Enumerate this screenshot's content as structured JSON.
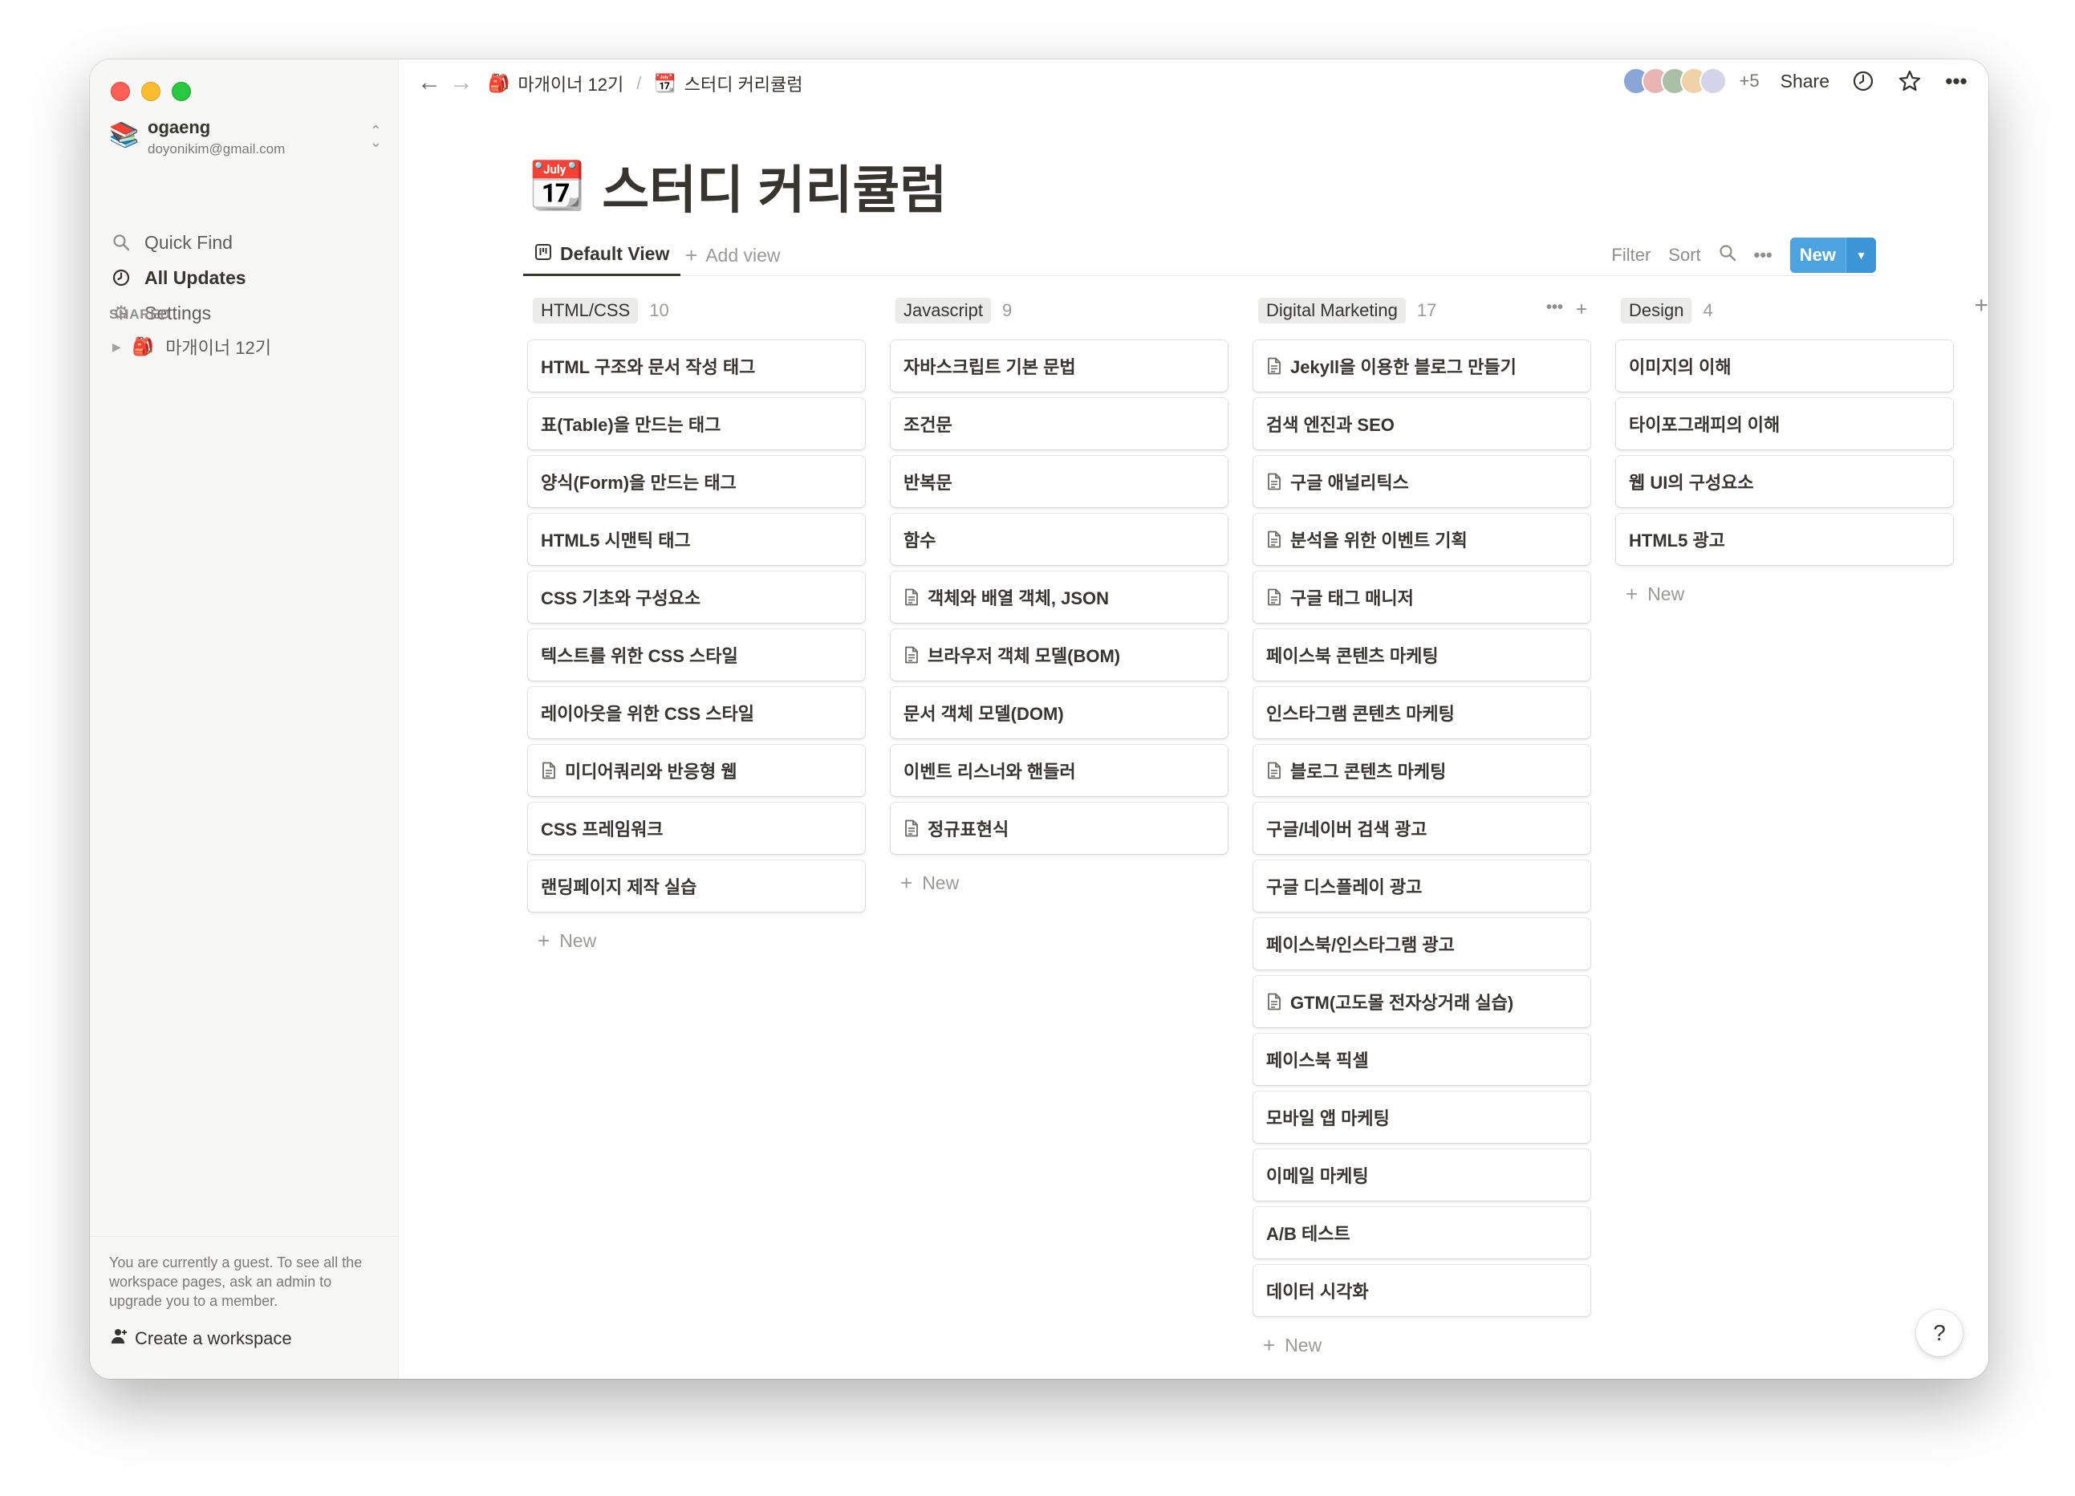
{
  "window": {
    "traffic_lights": [
      "close",
      "minimize",
      "maximize"
    ]
  },
  "sidebar": {
    "workspace": {
      "icon": "📚",
      "name": "ogaeng",
      "email": "doyonikim@gmail.com"
    },
    "nav": [
      {
        "label": "Quick Find",
        "icon": "search-icon"
      },
      {
        "label": "All Updates",
        "icon": "clock-icon"
      },
      {
        "label": "Settings",
        "icon": "gear-icon"
      }
    ],
    "shared_label": "SHARED",
    "shared_items": [
      {
        "label": "마개이너 12기",
        "icon": "🎒"
      }
    ],
    "guest_text": "You are currently a guest. To see all the workspace pages, ask an admin to upgrade you to a member.",
    "create_workspace": "Create a workspace"
  },
  "topbar": {
    "breadcrumb": [
      {
        "label": "마개이너 12기",
        "icon": "🎒"
      },
      {
        "label": "스터디 커리큘럼",
        "icon": "📆"
      }
    ],
    "separator": "/",
    "avatars_more": "+5",
    "share": "Share"
  },
  "page": {
    "icon": "📆",
    "title": "스터디 커리큘럼"
  },
  "views": {
    "active": "Default View",
    "add": "Add view",
    "filter": "Filter",
    "sort": "Sort",
    "new": "New"
  },
  "board": {
    "new_label": "New",
    "columns": [
      {
        "name": "HTML/CSS",
        "count": "10",
        "cards": [
          {
            "title": "HTML 구조와 문서 작성 태그",
            "doc": false
          },
          {
            "title": "표(Table)을 만드는 태그",
            "doc": false
          },
          {
            "title": "양식(Form)을 만드는 태그",
            "doc": false
          },
          {
            "title": "HTML5 시맨틱 태그",
            "doc": false
          },
          {
            "title": "CSS 기초와 구성요소",
            "doc": false
          },
          {
            "title": "텍스트를 위한 CSS 스타일",
            "doc": false
          },
          {
            "title": "레이아웃을 위한 CSS 스타일",
            "doc": false
          },
          {
            "title": "미디어쿼리와 반응형 웹",
            "doc": true
          },
          {
            "title": "CSS 프레임워크",
            "doc": false
          },
          {
            "title": "랜딩페이지 제작 실습",
            "doc": false
          }
        ]
      },
      {
        "name": "Javascript",
        "count": "9",
        "cards": [
          {
            "title": "자바스크립트 기본 문법",
            "doc": false
          },
          {
            "title": "조건문",
            "doc": false
          },
          {
            "title": "반복문",
            "doc": false
          },
          {
            "title": "함수",
            "doc": false
          },
          {
            "title": "객체와 배열 객체, JSON",
            "doc": true
          },
          {
            "title": "브라우저 객체 모델(BOM)",
            "doc": true
          },
          {
            "title": "문서 객체 모델(DOM)",
            "doc": false
          },
          {
            "title": "이벤트 리스너와 핸들러",
            "doc": false
          },
          {
            "title": "정규표현식",
            "doc": true
          }
        ]
      },
      {
        "name": "Digital Marketing",
        "count": "17",
        "cards": [
          {
            "title": "Jekyll을 이용한 블로그 만들기",
            "doc": true
          },
          {
            "title": "검색 엔진과 SEO",
            "doc": false
          },
          {
            "title": "구글 애널리틱스",
            "doc": true
          },
          {
            "title": "분석을 위한 이벤트 기획",
            "doc": true
          },
          {
            "title": "구글 태그 매니저",
            "doc": true
          },
          {
            "title": "페이스북 콘텐츠 마케팅",
            "doc": false
          },
          {
            "title": "인스타그램 콘텐츠 마케팅",
            "doc": false
          },
          {
            "title": "블로그 콘텐츠 마케팅",
            "doc": true
          },
          {
            "title": "구글/네이버 검색 광고",
            "doc": false
          },
          {
            "title": "구글 디스플레이 광고",
            "doc": false
          },
          {
            "title": "페이스북/인스타그램 광고",
            "doc": false
          },
          {
            "title": "GTM(고도몰 전자상거래 실습)",
            "doc": true
          },
          {
            "title": "페이스북 픽셀",
            "doc": false
          },
          {
            "title": "모바일 앱 마케팅",
            "doc": false
          },
          {
            "title": "이메일 마케팅",
            "doc": false
          },
          {
            "title": "A/B 테스트",
            "doc": false
          },
          {
            "title": "데이터 시각화",
            "doc": false
          }
        ]
      },
      {
        "name": "Design",
        "count": "4",
        "cards": [
          {
            "title": "이미지의 이해",
            "doc": false
          },
          {
            "title": "타이포그래피의 이해",
            "doc": false
          },
          {
            "title": "웹 UI의 구성요소",
            "doc": false
          },
          {
            "title": "HTML5 광고",
            "doc": false
          }
        ]
      }
    ]
  },
  "help": "?",
  "colors": {
    "accent": "#4da3e0",
    "text": "#37352f",
    "muted": "#9b9a97",
    "sidebar_bg": "#f7f7f5"
  }
}
